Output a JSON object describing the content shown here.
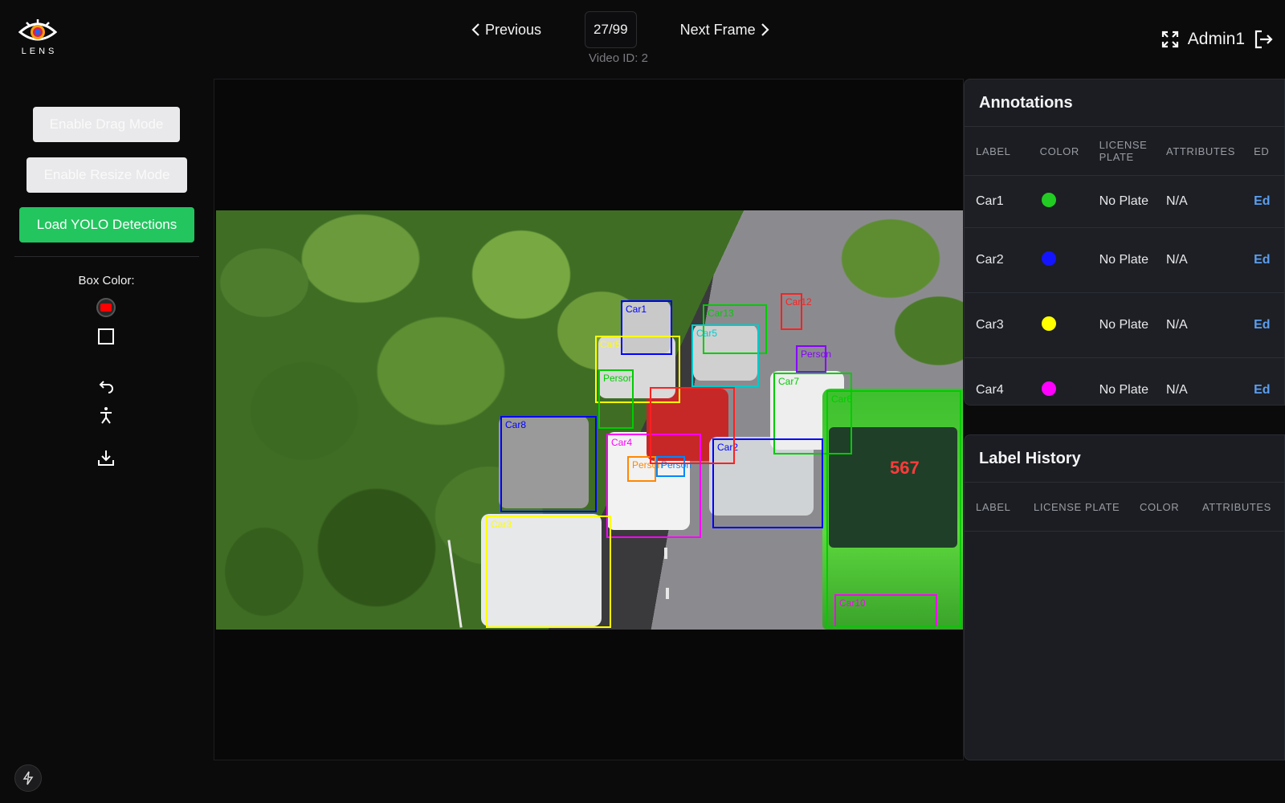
{
  "app": {
    "logo_text": "LENS",
    "admin_name": "Admin1"
  },
  "nav": {
    "prev_label": "Previous",
    "next_label": "Next Frame",
    "frame_counter": "27/99",
    "video_id": "Video ID: 2"
  },
  "toolbar": {
    "drag_mode_label": "Enable Drag Mode",
    "resize_mode_label": "Enable Resize Mode",
    "yolo_label": "Load YOLO Detections",
    "box_color_label": "Box Color:",
    "selected_color": "#ff0000"
  },
  "frame": {
    "bus_number": "567",
    "boxes": [
      {
        "label": "Car1",
        "color": "#0000ff"
      },
      {
        "label": "Car13",
        "color": "#00cc00"
      },
      {
        "label": "Car12",
        "color": "#ff2020"
      },
      {
        "label": "Car5",
        "color": "#ffff00"
      },
      {
        "label": "Car5",
        "color": "#00cccc"
      },
      {
        "label": "Person",
        "color": "#8800ff"
      },
      {
        "label": "Person",
        "color": "#00cc00"
      },
      {
        "label": "Car7",
        "color": "#00cc00"
      },
      {
        "label": "Car8",
        "color": "#0000ff"
      },
      {
        "label": "Car4",
        "color": "#ff00ff"
      },
      {
        "label": "Person",
        "color": "#ff8800"
      },
      {
        "label": "Person",
        "color": "#0088ff"
      },
      {
        "label": "Car2",
        "color": "#0000ff"
      },
      {
        "label": "Car3",
        "color": "#ffff00"
      },
      {
        "label": "Car10",
        "color": "#ff00ff"
      },
      {
        "label": "Car6",
        "color": "#00cc00"
      }
    ]
  },
  "annotations": {
    "title": "Annotations",
    "headers": {
      "label": "LABEL",
      "color": "COLOR",
      "plate": "LICENSE PLATE",
      "attributes": "ATTRIBUTES",
      "edit": "ED"
    },
    "rows": [
      {
        "label": "Car1",
        "color": "#22cc22",
        "plate": "No Plate",
        "attributes": "N/A",
        "action": "Ed"
      },
      {
        "label": "Car2",
        "color": "#1414ff",
        "plate": "No Plate",
        "attributes": "N/A",
        "action": "Ed"
      },
      {
        "label": "Car3",
        "color": "#ffff00",
        "plate": "No Plate",
        "attributes": "N/A",
        "action": "Ed"
      },
      {
        "label": "Car4",
        "color": "#ff00ff",
        "plate": "No Plate",
        "attributes": "N/A",
        "action": "Ed"
      }
    ]
  },
  "history": {
    "title": "Label History",
    "headers": {
      "label": "LABEL",
      "plate": "LICENSE PLATE",
      "color": "COLOR",
      "attributes": "ATTRIBUTES"
    }
  },
  "icons": {
    "prev": "chevron-left-icon",
    "next": "chevron-right-icon",
    "fullscreen": "fullscreen-icon",
    "logout": "logout-icon",
    "undo": "undo-icon",
    "person": "person-icon",
    "download": "download-icon",
    "bolt": "bolt-icon"
  }
}
